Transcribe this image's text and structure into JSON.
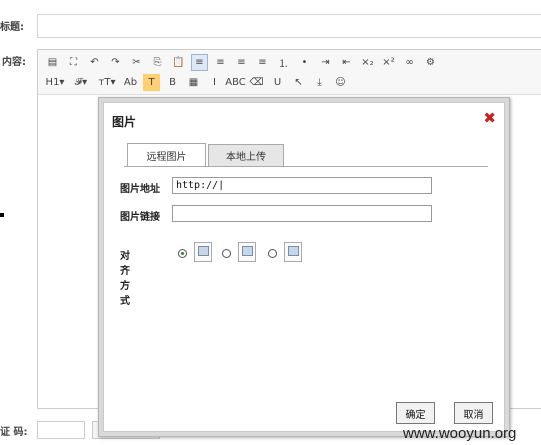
{
  "form": {
    "title_label": "标题:",
    "content_label": "内容:",
    "captcha_label": "证 码:"
  },
  "toolbar": {
    "row1": [
      {
        "icon": "source-icon",
        "glyph": "▤"
      },
      {
        "icon": "fullscreen-icon",
        "glyph": "⛶"
      },
      {
        "icon": "undo-icon",
        "glyph": "↶"
      },
      {
        "icon": "redo-icon",
        "glyph": "↷"
      },
      {
        "icon": "cut-icon",
        "glyph": "✂"
      },
      {
        "icon": "copy-icon",
        "glyph": "⎘"
      },
      {
        "icon": "paste-icon",
        "glyph": "📋"
      },
      {
        "icon": "align-left-icon",
        "glyph": "≡",
        "active": true
      },
      {
        "icon": "align-center-icon",
        "glyph": "≡"
      },
      {
        "icon": "align-right-icon",
        "glyph": "≡"
      },
      {
        "icon": "justify-icon",
        "glyph": "≡"
      },
      {
        "icon": "ordered-list-icon",
        "glyph": "⒈"
      },
      {
        "icon": "unordered-list-icon",
        "glyph": "•"
      },
      {
        "icon": "indent-icon",
        "glyph": "⇥"
      },
      {
        "icon": "outdent-icon",
        "glyph": "⇤"
      },
      {
        "icon": "subscript-icon",
        "glyph": "×₂"
      },
      {
        "icon": "superscript-icon",
        "glyph": "×²"
      },
      {
        "icon": "link-icon",
        "glyph": "∞"
      },
      {
        "icon": "unlink-icon",
        "glyph": "⚙"
      }
    ],
    "row2": [
      {
        "icon": "heading-icon",
        "glyph": "H1▾",
        "wide": true
      },
      {
        "icon": "font-family-icon",
        "glyph": "𝓕▾",
        "wide": true
      },
      {
        "icon": "font-size-icon",
        "glyph": "тT▾",
        "wide": true
      },
      {
        "icon": "text-color-icon",
        "glyph": "Ab"
      },
      {
        "icon": "highlight-icon",
        "glyph": "T",
        "hl": true
      },
      {
        "icon": "bold-icon",
        "glyph": "B"
      },
      {
        "icon": "strikethrough-bg-icon",
        "glyph": "▦"
      },
      {
        "icon": "italic-icon",
        "glyph": "I"
      },
      {
        "icon": "abc-icon",
        "glyph": "ABC"
      },
      {
        "icon": "eraser-icon",
        "glyph": "⌫"
      },
      {
        "icon": "underline-icon",
        "glyph": "U"
      },
      {
        "icon": "cursor-icon",
        "glyph": "↖"
      },
      {
        "icon": "insert-icon",
        "glyph": "⤓"
      },
      {
        "icon": "emoticon-icon",
        "glyph": "☺"
      }
    ]
  },
  "dialog": {
    "title": "图片",
    "close_glyph": "✖",
    "tabs": [
      "远程图片",
      "本地上传"
    ],
    "url_label": "图片地址",
    "url_value": "http://|",
    "link_label": "图片链接",
    "link_value": "",
    "align_label": "对齐方式",
    "align_selected": 0,
    "ok_label": "确定",
    "cancel_label": "取消"
  },
  "watermark": "www.wooyun.org"
}
